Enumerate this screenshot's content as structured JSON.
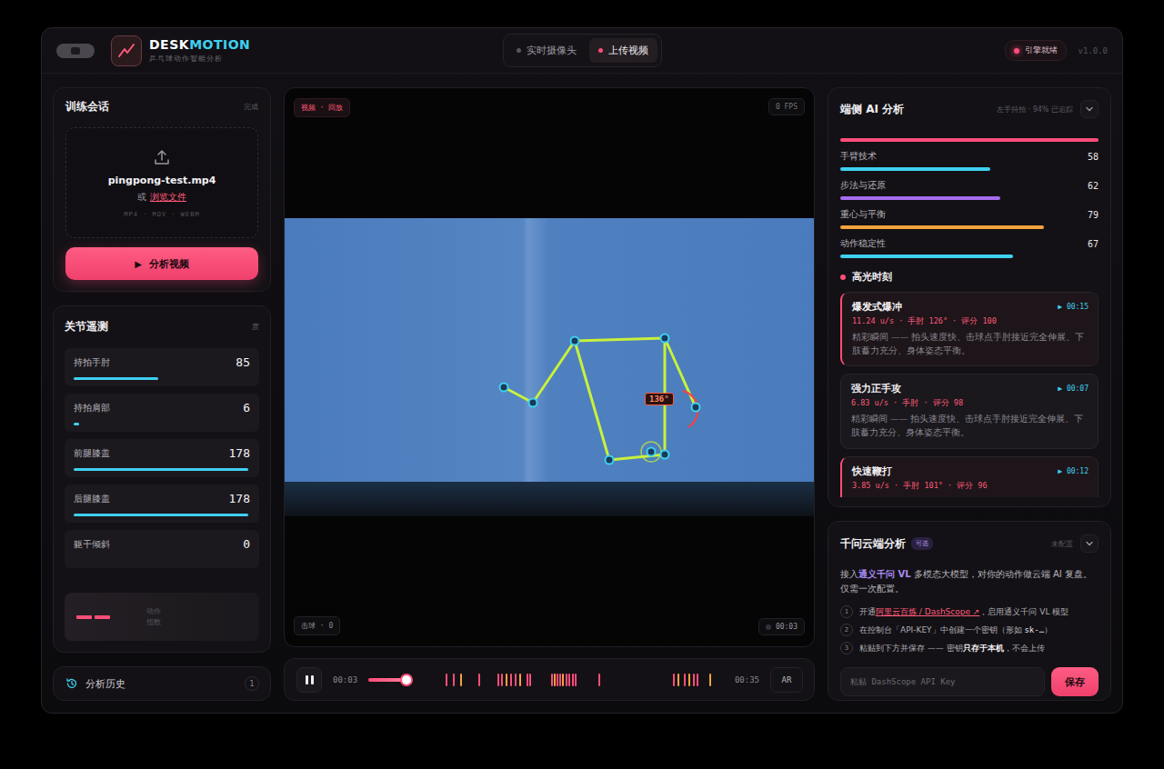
{
  "app": {
    "brand_a": "DESK",
    "brand_b": "MOTION",
    "subtitle": "乒乓球动作智能分析",
    "version": "v1.0.0",
    "engine": {
      "label": "引擎就绪",
      "ready": true
    }
  },
  "mode_tabs": [
    {
      "label": "实时摄像头",
      "selected": false
    },
    {
      "label": "上传视频",
      "selected": true
    }
  ],
  "session": {
    "title": "训练会话",
    "status": "完成",
    "file": "pingpong-test.mp4",
    "or": "或",
    "browse": "浏览文件",
    "formats": "MP4 · MOV · WEBM",
    "analyze_icon": "▶",
    "analyze": "分析视频"
  },
  "telemetry": {
    "title": "关节遥测",
    "unit": "度",
    "joints": [
      {
        "label": "持拍手肘",
        "value": "85",
        "level": 0.48
      },
      {
        "label": "持拍肩部",
        "value": "6",
        "level": 0.03
      },
      {
        "label": "前腿膝盖",
        "value": "178",
        "level": 0.99
      },
      {
        "label": "后腿膝盖",
        "value": "178",
        "level": 0.99
      },
      {
        "label": "躯干倾斜",
        "value": "0",
        "level": 0
      }
    ],
    "index_card": {
      "label": "动作指数"
    }
  },
  "history": {
    "label": "分析历史",
    "count": "1"
  },
  "video": {
    "tag": "视频 · 回放",
    "fps": "0 FPS",
    "hits": "击球 · 0",
    "timestamp": "00:03",
    "angle": "136°"
  },
  "player": {
    "playing": true,
    "current": "00:03",
    "level": 0.9,
    "duration": "00:35",
    "ar": "AR",
    "markers": [
      {
        "t": 0.032,
        "color": "#ff4d7a"
      },
      {
        "t": 0.058,
        "color": "#ff4d7a"
      },
      {
        "t": 0.084,
        "color": "#f5a33c"
      },
      {
        "t": 0.148,
        "color": "#ff4d7a"
      },
      {
        "t": 0.216,
        "color": "#ff4d7a"
      },
      {
        "t": 0.229,
        "color": "#ff4d7a"
      },
      {
        "t": 0.245,
        "color": "#f5a33c"
      },
      {
        "t": 0.261,
        "color": "#ff4d7a"
      },
      {
        "t": 0.277,
        "color": "#ff4d7a"
      },
      {
        "t": 0.294,
        "color": "#f5a33c"
      },
      {
        "t": 0.319,
        "color": "#ff4d7a"
      },
      {
        "t": 0.329,
        "color": "#ff4d7a"
      },
      {
        "t": 0.406,
        "color": "#ff4d7a"
      },
      {
        "t": 0.416,
        "color": "#f5a33c"
      },
      {
        "t": 0.426,
        "color": "#ff4d7a"
      },
      {
        "t": 0.435,
        "color": "#ff4d7a"
      },
      {
        "t": 0.445,
        "color": "#f5a33c"
      },
      {
        "t": 0.458,
        "color": "#ff4d7a"
      },
      {
        "t": 0.468,
        "color": "#ff4d7a"
      },
      {
        "t": 0.481,
        "color": "#ff4d7a"
      },
      {
        "t": 0.49,
        "color": "#ff4d7a"
      },
      {
        "t": 0.574,
        "color": "#ff4d7a"
      },
      {
        "t": 0.839,
        "color": "#ff4d7a"
      },
      {
        "t": 0.855,
        "color": "#f5a33c"
      },
      {
        "t": 0.877,
        "color": "#ff4d7a"
      },
      {
        "t": 0.894,
        "color": "#f5a33c"
      },
      {
        "t": 0.91,
        "color": "#ff4d7a"
      },
      {
        "t": 0.923,
        "color": "#ff4d7a"
      },
      {
        "t": 0.968,
        "color": "#f5a33c"
      }
    ]
  },
  "ai": {
    "title": "端侧 AI 分析",
    "status": "左手持拍 · 94% 已追踪",
    "expanded": true,
    "lead_bar": {
      "level": 1.0,
      "color": "#ff4d7a"
    },
    "scores": [
      {
        "label": "手臂技术",
        "value": "58",
        "level": 0.58,
        "color": "#3fd0f0"
      },
      {
        "label": "步法与还原",
        "value": "62",
        "level": 0.62,
        "color": "#a66cf0"
      },
      {
        "label": "重心与平衡",
        "value": "79",
        "level": 0.79,
        "color": "#f5a33c"
      },
      {
        "label": "动作稳定性",
        "value": "67",
        "level": 0.67,
        "color": "#3fd0f0"
      }
    ],
    "highlights_title": "高光时刻",
    "highlights": [
      {
        "title": "爆发式爆冲",
        "time": "▶ 00:15",
        "meta": "11.24 u/s · 手肘 126° · 评分 100",
        "desc": "精彩瞬间 —— 拍头速度快、击球点手肘接近完全伸展、下肢蓄力充分、身体姿态平衡。",
        "selected": true
      },
      {
        "title": "强力正手攻",
        "time": "▶ 00:07",
        "meta": "6.83 u/s · 手肘 · 评分 98",
        "desc": "精彩瞬间 —— 拍头速度快、击球点手肘接近完全伸展、下肢蓄力充分、身体姿态平衡。",
        "selected": false
      },
      {
        "title": "快速鞭打",
        "time": "▶ 00:12",
        "meta": "3.85 u/s · 手肘 101° · 评分 96",
        "desc": "",
        "selected": true
      }
    ]
  },
  "cloud": {
    "title": "千问云端分析",
    "badge": "可选",
    "status": "未配置",
    "expanded": true,
    "intro": [
      {
        "text": "接入",
        "kind": "plain"
      },
      {
        "text": "通义千问 VL",
        "kind": "strong"
      },
      {
        "text": " 多模态大模型，对你的动作做云端 AI 复盘。仅需一次配置。",
        "kind": "plain"
      }
    ],
    "steps": [
      {
        "num": "1",
        "parts": [
          {
            "text": "开通",
            "kind": "plain"
          },
          {
            "text": "阿里云百炼 / DashScope ↗",
            "kind": "link"
          },
          {
            "text": "，启用通义千问 VL 模型",
            "kind": "plain"
          }
        ]
      },
      {
        "num": "2",
        "parts": [
          {
            "text": "在控制台「API-KEY」中创建一个密钥（形如 ",
            "kind": "plain"
          },
          {
            "text": "sk-…",
            "kind": "code"
          },
          {
            "text": "）",
            "kind": "plain"
          }
        ]
      },
      {
        "num": "3",
        "parts": [
          {
            "text": "粘贴到下方并保存 —— 密钥",
            "kind": "plain"
          },
          {
            "text": "只存于本机",
            "kind": "bold"
          },
          {
            "text": "，不会上传",
            "kind": "plain"
          }
        ]
      }
    ],
    "placeholder": "粘贴 DashScope API Key",
    "save": "保存"
  }
}
